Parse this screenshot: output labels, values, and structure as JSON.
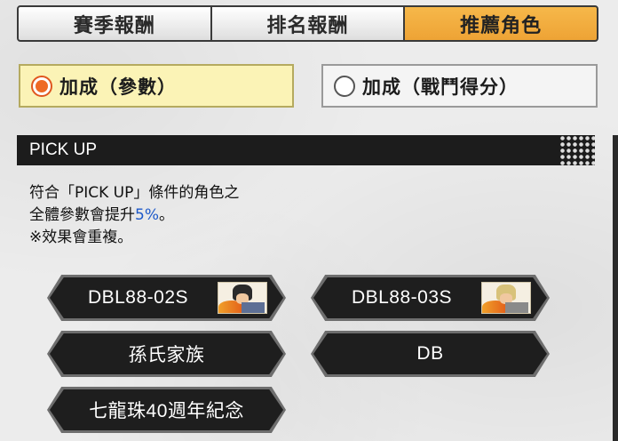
{
  "tabs": [
    {
      "label": "賽季報酬",
      "active": false
    },
    {
      "label": "排名報酬",
      "active": false
    },
    {
      "label": "推薦角色",
      "active": true
    }
  ],
  "bonus_options": [
    {
      "label": "加成（參數）",
      "selected": true
    },
    {
      "label": "加成（戰鬥得分）",
      "selected": false
    }
  ],
  "section": {
    "title": "PICK UP"
  },
  "description": {
    "line1": "符合「PICK UP」條件的角色之",
    "line2_prefix": "全體參數會提升",
    "line2_value": "5%",
    "line2_suffix": "。",
    "line3": "※效果會重複。"
  },
  "tags": [
    {
      "label": "DBL88-02S",
      "icon": "character-portrait-icon"
    },
    {
      "label": "DBL88-03S",
      "icon": "character-portrait-icon"
    },
    {
      "label": "孫氏家族"
    },
    {
      "label": "DB"
    },
    {
      "label": "七龍珠40週年紀念"
    }
  ],
  "colors": {
    "active_tab": "#F0A83C",
    "selected_radio_bg": "#FBF3B6",
    "radio_accent": "#EE6A25",
    "section_header_bg": "#1C1C1C",
    "highlight_text": "#1D59C9",
    "tag_bg": "#1E1E1E"
  }
}
